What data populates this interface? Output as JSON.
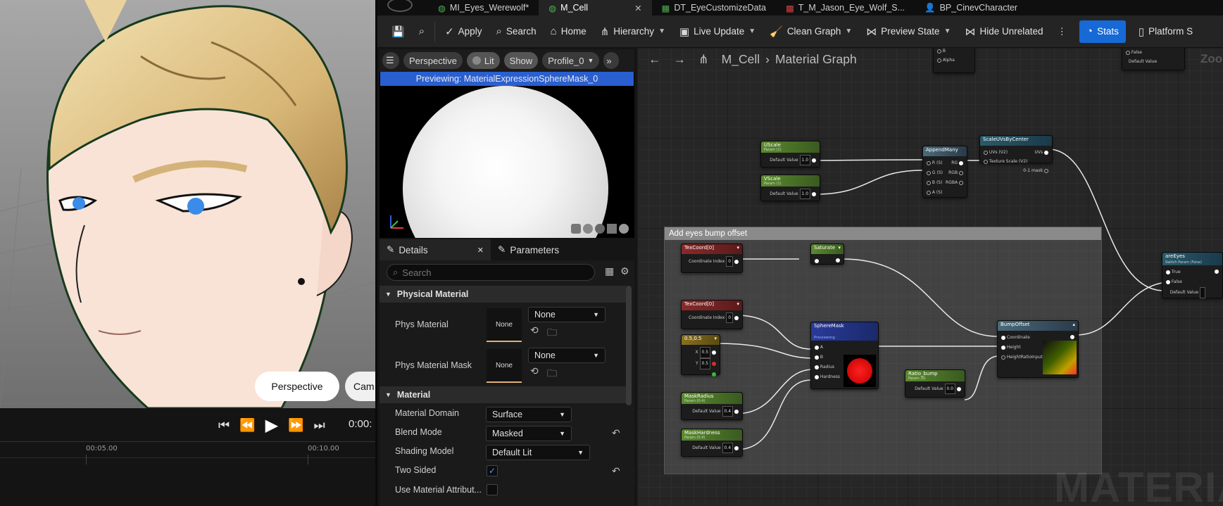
{
  "tabs": [
    {
      "label": "MI_Eyes_Werewolf*",
      "icon": "material-instance-icon"
    },
    {
      "label": "M_Cell",
      "icon": "material-icon",
      "active": true
    },
    {
      "label": "DT_EyeCustomizeData",
      "icon": "data-table-icon"
    },
    {
      "label": "T_M_Jason_Eye_Wolf_S...",
      "icon": "texture-icon"
    },
    {
      "label": "BP_CinevCharacter",
      "icon": "blueprint-icon"
    }
  ],
  "toolbar": {
    "apply": "Apply",
    "search": "Search",
    "home": "Home",
    "hierarchy": "Hierarchy",
    "live_update": "Live Update",
    "clean_graph": "Clean Graph",
    "preview_state": "Preview State",
    "hide_unrelated": "Hide Unrelated",
    "stats": "Stats",
    "platform": "Platform S"
  },
  "viewport": {
    "perspective": "Perspective",
    "camera": "Cam"
  },
  "sequencer": {
    "time": "0:00:",
    "tick1": "00:05.00",
    "tick2": "00:10.00"
  },
  "preview": {
    "perspective": "Perspective",
    "lit": "Lit",
    "show": "Show",
    "profile": "Profile_0",
    "banner": "Previewing: MaterialExpressionSphereMask_0"
  },
  "details": {
    "tab_details": "Details",
    "tab_parameters": "Parameters",
    "search_placeholder": "Search",
    "section_physical": "Physical Material",
    "phys_material": "Phys Material",
    "phys_material_value": "None",
    "phys_material_thumb": "None",
    "phys_material_mask": "Phys Material Mask",
    "phys_material_mask_value": "None",
    "phys_material_mask_thumb": "None",
    "section_material": "Material",
    "material_domain": "Material Domain",
    "material_domain_value": "Surface",
    "blend_mode": "Blend Mode",
    "blend_mode_value": "Masked",
    "shading_model": "Shading Model",
    "shading_model_value": "Default Lit",
    "two_sided": "Two Sided",
    "two_sided_checked": true,
    "use_material_attributes": "Use Material Attribut...",
    "use_material_attributes_checked": false
  },
  "graph": {
    "breadcrumb_root": "M_Cell",
    "breadcrumb_page": "Material Graph",
    "watermark": "MATERIAL",
    "zoom_hint": "Zoo",
    "comment_title": "Add eyes bump offset",
    "nodes": {
      "uscale": {
        "title": "UScale",
        "sub": "Param (1)",
        "label": "Default Value",
        "value": "1.0"
      },
      "vscale": {
        "title": "VScale",
        "sub": "Param (1)",
        "label": "Default Value",
        "value": "1.0"
      },
      "append": {
        "title": "AppendMany",
        "pins": [
          "R (S)",
          "G (S)",
          "B (S)",
          "A (S)"
        ],
        "outs": [
          "RG",
          "RGB",
          "RGBA"
        ]
      },
      "scaleuv": {
        "title": "ScaleUVsByCenter",
        "pins": [
          "UVs (V2)",
          "Texture Scale (V2)"
        ],
        "outs": [
          "UVs",
          "0-1 mask"
        ]
      },
      "texcoord1": {
        "title": "TexCoord[0]",
        "label": "Coordinate Index",
        "value": "0"
      },
      "texcoord2": {
        "title": "TexCoord[0]",
        "label": "Coordinate Index",
        "value": "0"
      },
      "saturate": {
        "title": "Saturate"
      },
      "vec": {
        "title": "0.5,0.5",
        "x": "0.5",
        "y": "0.5"
      },
      "spheremask": {
        "title": "SphereMask",
        "sub": "Previewing",
        "pins": [
          "A",
          "B",
          "Radius",
          "Hardness"
        ]
      },
      "maskradius": {
        "title": "MaskRadius",
        "sub": "Param (0.4)",
        "label": "Default Value",
        "value": "0.4"
      },
      "maskhardness": {
        "title": "MaskHardness",
        "sub": "Param (0.4)",
        "label": "Default Value",
        "value": "0.4"
      },
      "ratiobump": {
        "title": "Ratio_bump",
        "sub": "Param (0)",
        "label": "Default Value",
        "value": "0.0"
      },
      "bumpoffset": {
        "title": "BumpOffset",
        "pins": [
          "Coordinate",
          "Height",
          "HeightRatioInput"
        ]
      },
      "areeyes": {
        "title": "areEyes",
        "sub": "Switch Param (False)",
        "pins": [
          "True",
          "False",
          "Default Value"
        ]
      },
      "topright": {
        "pins": [
          "False",
          "Default Value"
        ]
      },
      "topleft": {
        "pins": [
          "B",
          "Alpha"
        ]
      }
    }
  }
}
